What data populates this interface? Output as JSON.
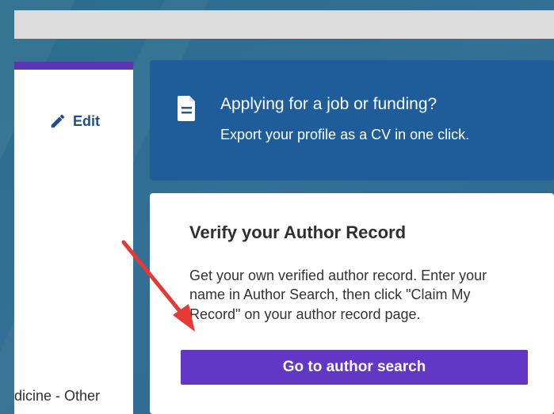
{
  "left_panel": {
    "edit_label": "Edit",
    "bottom_text": "dicine - Other",
    "accent_color": "#5b35b2"
  },
  "job_card": {
    "title": "Applying for a job or funding?",
    "subtitle": "Export your profile as a CV in one click.",
    "icon": "document-icon",
    "background_color": "#1f5d9a"
  },
  "verify_card": {
    "title": "Verify your Author Record",
    "description_lines": [
      "Get your own verified author record. Enter your",
      "name in Author Search, then click \"Claim My",
      "Record\" on your author record page."
    ],
    "button_label": "Go to author search",
    "button_color": "#6137c3"
  },
  "annotation": {
    "type": "red-arrow",
    "color": "#e53935"
  }
}
